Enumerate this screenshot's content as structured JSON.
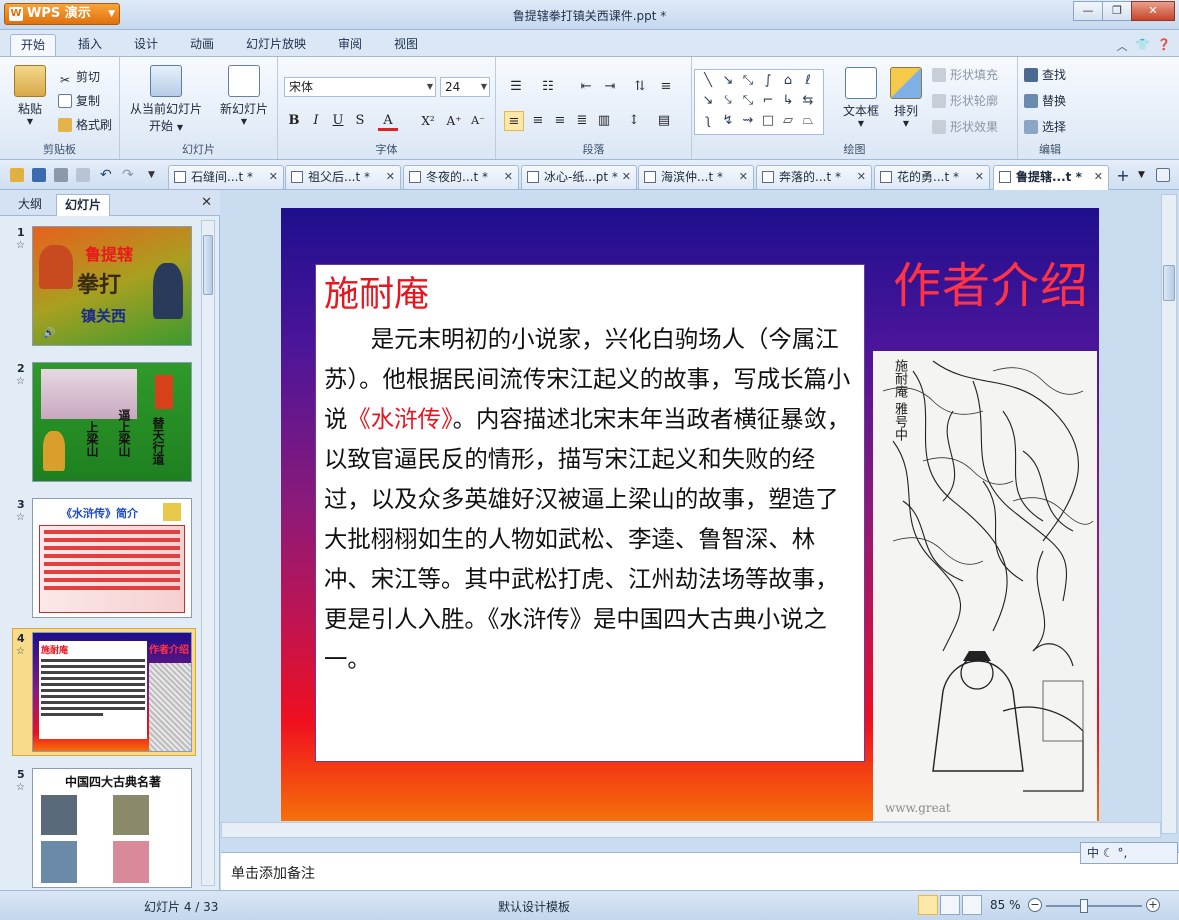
{
  "app": {
    "logo_text": "WPS 演示",
    "window_title": "鲁提辖拳打镇关西课件.ppt *"
  },
  "menu": {
    "tabs": [
      "开始",
      "插入",
      "设计",
      "动画",
      "幻灯片放映",
      "审阅",
      "视图"
    ],
    "active": "开始"
  },
  "ribbon": {
    "clipboard": {
      "paste": "粘贴",
      "cut": "剪切",
      "copy": "复制",
      "format_painter": "格式刷",
      "label": "剪贴板"
    },
    "slides": {
      "from_current": "从当前幻灯片",
      "start": "开始",
      "new_slide": "新幻灯片",
      "label": "幻灯片"
    },
    "font": {
      "font_name": "宋体",
      "font_size": "24",
      "bold": "B",
      "italic": "I",
      "underline": "U",
      "shadow": "S",
      "color": "A",
      "superscript": "X²",
      "grow": "A⁺",
      "shrink": "A⁻",
      "label": "字体"
    },
    "paragraph": {
      "label": "段落"
    },
    "drawing": {
      "textbox": "文本框",
      "arrange": "排列",
      "shape_fill": "形状填充",
      "shape_outline": "形状轮廓",
      "shape_effect": "形状效果",
      "label": "绘图"
    },
    "editing": {
      "find": "查找",
      "replace": "替换",
      "select": "选择",
      "label": "编辑"
    }
  },
  "doc_tabs": [
    {
      "label": "石缝间...t *",
      "active": false
    },
    {
      "label": "祖父后...t *",
      "active": false
    },
    {
      "label": "冬夜的...t *",
      "active": false
    },
    {
      "label": "冰心-纸...pt *",
      "active": false
    },
    {
      "label": "海滨仲...t *",
      "active": false
    },
    {
      "label": "奔落的...t *",
      "active": false
    },
    {
      "label": "花的勇...t *",
      "active": false
    },
    {
      "label": "鲁提辖...t *",
      "active": true
    }
  ],
  "left_panel": {
    "tabs": [
      "大纲",
      "幻灯片"
    ],
    "active": "幻灯片",
    "thumbnails": [
      {
        "num": "1",
        "title_a": "鲁提辖",
        "title_b": "拳打",
        "title_c": "镇关西"
      },
      {
        "num": "2",
        "title_a": "上梁山",
        "title_b": "逼上梁山",
        "title_c": "替天行道"
      },
      {
        "num": "3",
        "title_a": "《水浒传》简介"
      },
      {
        "num": "4",
        "title_a": "施耐庵",
        "title_b": "作者介绍"
      },
      {
        "num": "5",
        "title_a": "中国四大古典名著"
      }
    ],
    "selected": "4"
  },
  "slide": {
    "heading": "作者介绍",
    "author": "施耐庵",
    "body_before": "是元末明初的小说家，兴化白驹场人（今属江苏）。他根据民间流传宋江起义的故事，写成长篇小说",
    "body_book": "《水浒传》",
    "body_after": "。内容描述北宋末年当政者横征暴敛，以致官逼民反的情形，描写宋江起义和失败的经过，以及众多英雄好汉被逼上梁山的故事，塑造了大批栩栩如生的人物如武松、李逵、鲁智深、林冲、宋江等。其中武松打虎、江州劫法场等故事，更是引人入胜。《水浒传》是中国四大古典小说之一。",
    "portrait_caption": "施耐庵 雅号中",
    "watermark": "www.great"
  },
  "notes": {
    "placeholder": "单击添加备注"
  },
  "ime": {
    "label": "中"
  },
  "status": {
    "slide_counter": "幻灯片 4 / 33",
    "template": "默认设计模板",
    "zoom": "85 %"
  },
  "colors": {
    "accent_orange": "#e2700c",
    "slide_heading": "#ff3344",
    "author_red": "#e8141e"
  }
}
